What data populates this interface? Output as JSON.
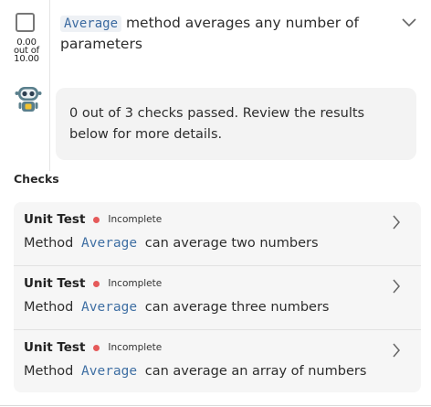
{
  "score": {
    "value": "0.00",
    "out_of": "out of",
    "max": "10.00"
  },
  "task": {
    "code": "Average",
    "text": " method averages any number of parameters"
  },
  "bubble": {
    "message": "0 out of 3 checks passed. Review the results below for more details."
  },
  "checks": {
    "title": "Checks",
    "items": [
      {
        "type": "Unit Test",
        "status": "Incomplete",
        "prefix": "Method",
        "code": "Average",
        "suffix": "can average two numbers"
      },
      {
        "type": "Unit Test",
        "status": "Incomplete",
        "prefix": "Method",
        "code": "Average",
        "suffix": "can average three numbers"
      },
      {
        "type": "Unit Test",
        "status": "Incomplete",
        "prefix": "Method",
        "code": "Average",
        "suffix": "can average an array of numbers"
      }
    ]
  },
  "colors": {
    "status_dot": "#e55a5a",
    "code_text": "#3b6aa0",
    "card_bg": "#f6f6f6"
  }
}
